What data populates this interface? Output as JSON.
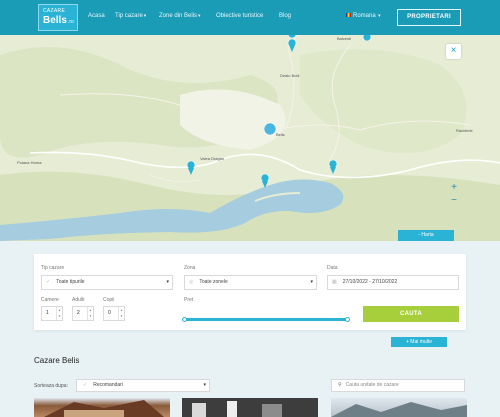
{
  "header": {
    "logo": {
      "line1": "CAZARE",
      "line2": "Bells",
      "line3": ".ro"
    },
    "nav": [
      {
        "label": "Acasa",
        "has_caret": false
      },
      {
        "label": "Tip cazare",
        "has_caret": true
      },
      {
        "label": "Zone din Belis",
        "has_caret": true
      },
      {
        "label": "Obiective turistice",
        "has_caret": false
      },
      {
        "label": "Blog",
        "has_caret": false
      }
    ],
    "language": "Romana",
    "owner_button": "PROPRIETARI"
  },
  "map": {
    "close_icon": "close-icon",
    "zoom_in": "+",
    "zoom_out": "−",
    "toggle_label": "- Harta",
    "place_labels": [
      "Poiana Horea",
      "Valea Dragan",
      "Belis",
      "Balcesti",
      "Dealu Botii",
      "Rachitele"
    ],
    "water_color": "#a5cddf",
    "land_color": "#e7ecd5",
    "marker_color": "#2bb3d6"
  },
  "search": {
    "type_label": "Tip cazare",
    "type_value": "Toate tipurile",
    "zone_label": "Zona",
    "zone_value": "Toate zonele",
    "date_label": "Data",
    "date_value": "27/10/2022 - 27/10/2022",
    "rooms_label": "Camere",
    "rooms_value": "1",
    "adults_label": "Adulti",
    "adults_value": "2",
    "children_label": "Copii",
    "children_value": "0",
    "price_label": "Pret",
    "search_button": "CAUTA",
    "more_filters": "+ Mai multe"
  },
  "listing": {
    "title": "Cazare Belis",
    "sort_label": "Sorteaza dupa:",
    "sort_value": "Recomandari",
    "search_placeholder": "Cauta unitate de cazare"
  },
  "colors": {
    "header": "#1a9bb6",
    "accent": "#2bb3d6",
    "search_button": "#a7cf3b"
  }
}
